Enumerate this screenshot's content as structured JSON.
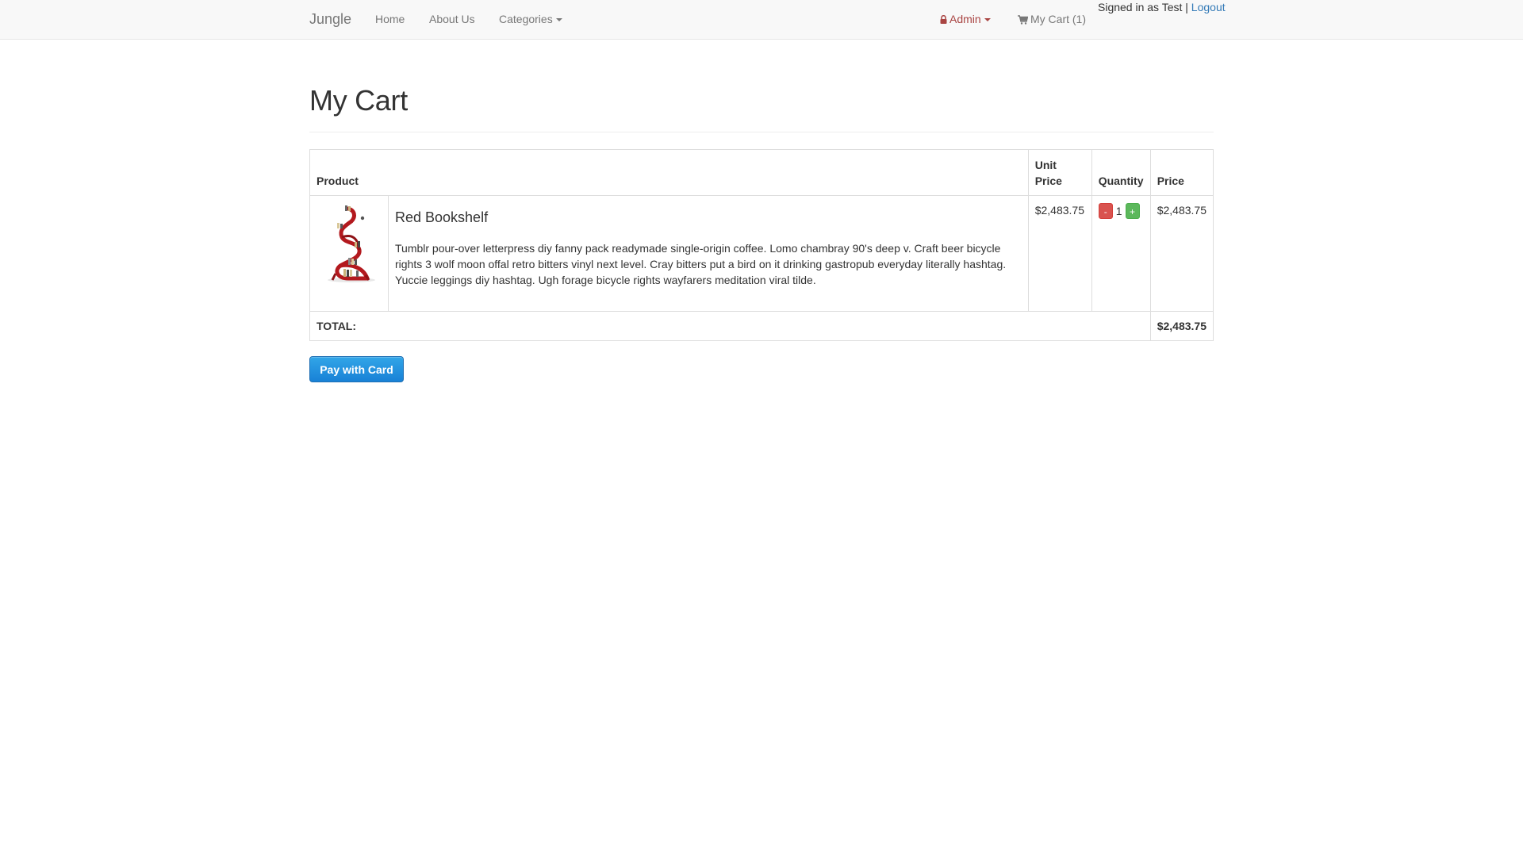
{
  "nav": {
    "brand": "Jungle",
    "home": "Home",
    "about": "About Us",
    "categories": "Categories",
    "admin": "Admin",
    "cart": "My Cart (1)",
    "signed_in_text": "Signed in as Test",
    "separator": "|",
    "logout": "Logout"
  },
  "page": {
    "title": "My Cart"
  },
  "table": {
    "headers": {
      "product": "Product",
      "unit_price": "Unit Price",
      "quantity": "Quantity",
      "price": "Price"
    },
    "items": [
      {
        "name": "Red Bookshelf",
        "description": "Tumblr pour-over letterpress diy fanny pack readymade single-origin coffee. Lomo chambray 90's deep v. Craft beer bicycle rights 3 wolf moon offal retro bitters vinyl next level. Cray bitters put a bird on it drinking gastropub everyday literally hashtag. Yuccie leggings diy hashtag. Ugh forage bicycle rights wayfarers meditation viral tilde.",
        "unit_price": "$2,483.75",
        "quantity": "1",
        "price": "$2,483.75",
        "decrement_label": "-",
        "increment_label": "+"
      }
    ],
    "total_label": "TOTAL:",
    "total_value": "$2,483.75"
  },
  "checkout": {
    "pay_label": "Pay with Card"
  },
  "colors": {
    "link": "#337ab7",
    "admin": "#a94442",
    "pay_button": "#1881d6",
    "decrement": "#d9534f",
    "increment": "#5cb85c"
  },
  "icons": {
    "admin": "lock-icon",
    "cart": "shopping-cart-icon",
    "dropdown": "caret-down-icon"
  }
}
